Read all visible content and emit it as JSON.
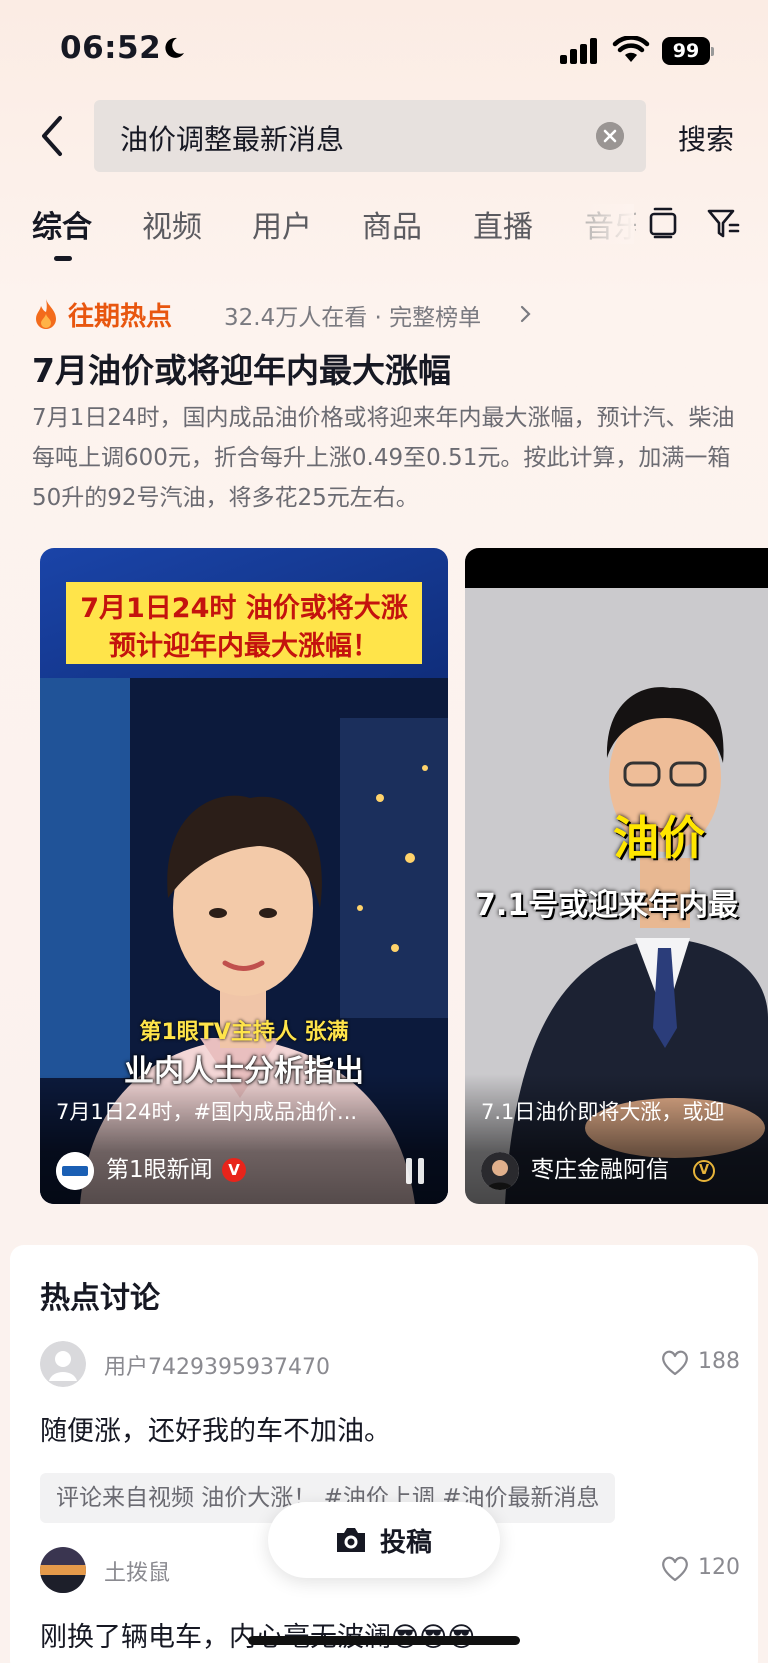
{
  "status_bar": {
    "time": "06:52",
    "battery": "99"
  },
  "search": {
    "query": "油价调整最新消息",
    "search_label": "搜索"
  },
  "tabs": [
    {
      "label": "综合"
    },
    {
      "label": "视频"
    },
    {
      "label": "用户"
    },
    {
      "label": "商品"
    },
    {
      "label": "直播"
    },
    {
      "label": "音乐"
    }
  ],
  "hot": {
    "label": "往期热点",
    "meta": "32.4万人在看 · 完整榜单",
    "title": "7月油价或将迎年内最大涨幅",
    "description": "7月1日24时，国内成品油价格或将迎来年内最大涨幅，预计汽、柴油每吨上调600元，折合每升上涨0.49至0.51元。按此计算，加满一箱50升的92号汽油，将多花25元左右。"
  },
  "videos": [
    {
      "caption_line1": "7月1日24时 油价或将大涨",
      "caption_line2": "预计迎年内最大涨幅！",
      "overlay_small": "第1眼TV主持人 张满",
      "overlay_big": "业内人士分析指出",
      "description": "7月1日24时，#国内成品油价...",
      "author": "第1眼新闻",
      "verified_mark": "V"
    },
    {
      "title": "油价",
      "subtitle": "7.1号或迎来年内最",
      "description": "7.1日油价即将大涨，或迎",
      "author": "枣庄金融阿信",
      "verified_mark": "V"
    }
  ],
  "discussion": {
    "title": "热点讨论",
    "comments": [
      {
        "user": "用户7429395937470",
        "likes": "188",
        "text": "随便涨，还好我的车不加油。",
        "source": "评论来自视频 油价大涨！ #油价上调 #油价最新消息"
      },
      {
        "user": "土拨鼠",
        "likes": "120",
        "text": "刚换了辆电车，内心毫无波澜😎😎😎"
      }
    ]
  },
  "post_button": {
    "label": "投稿"
  },
  "colors": {
    "accent_orange": "#e8560f",
    "caption_yellow": "#ffe44a",
    "verified_red": "#e8241b",
    "verified_gold": "#e7b43a"
  }
}
